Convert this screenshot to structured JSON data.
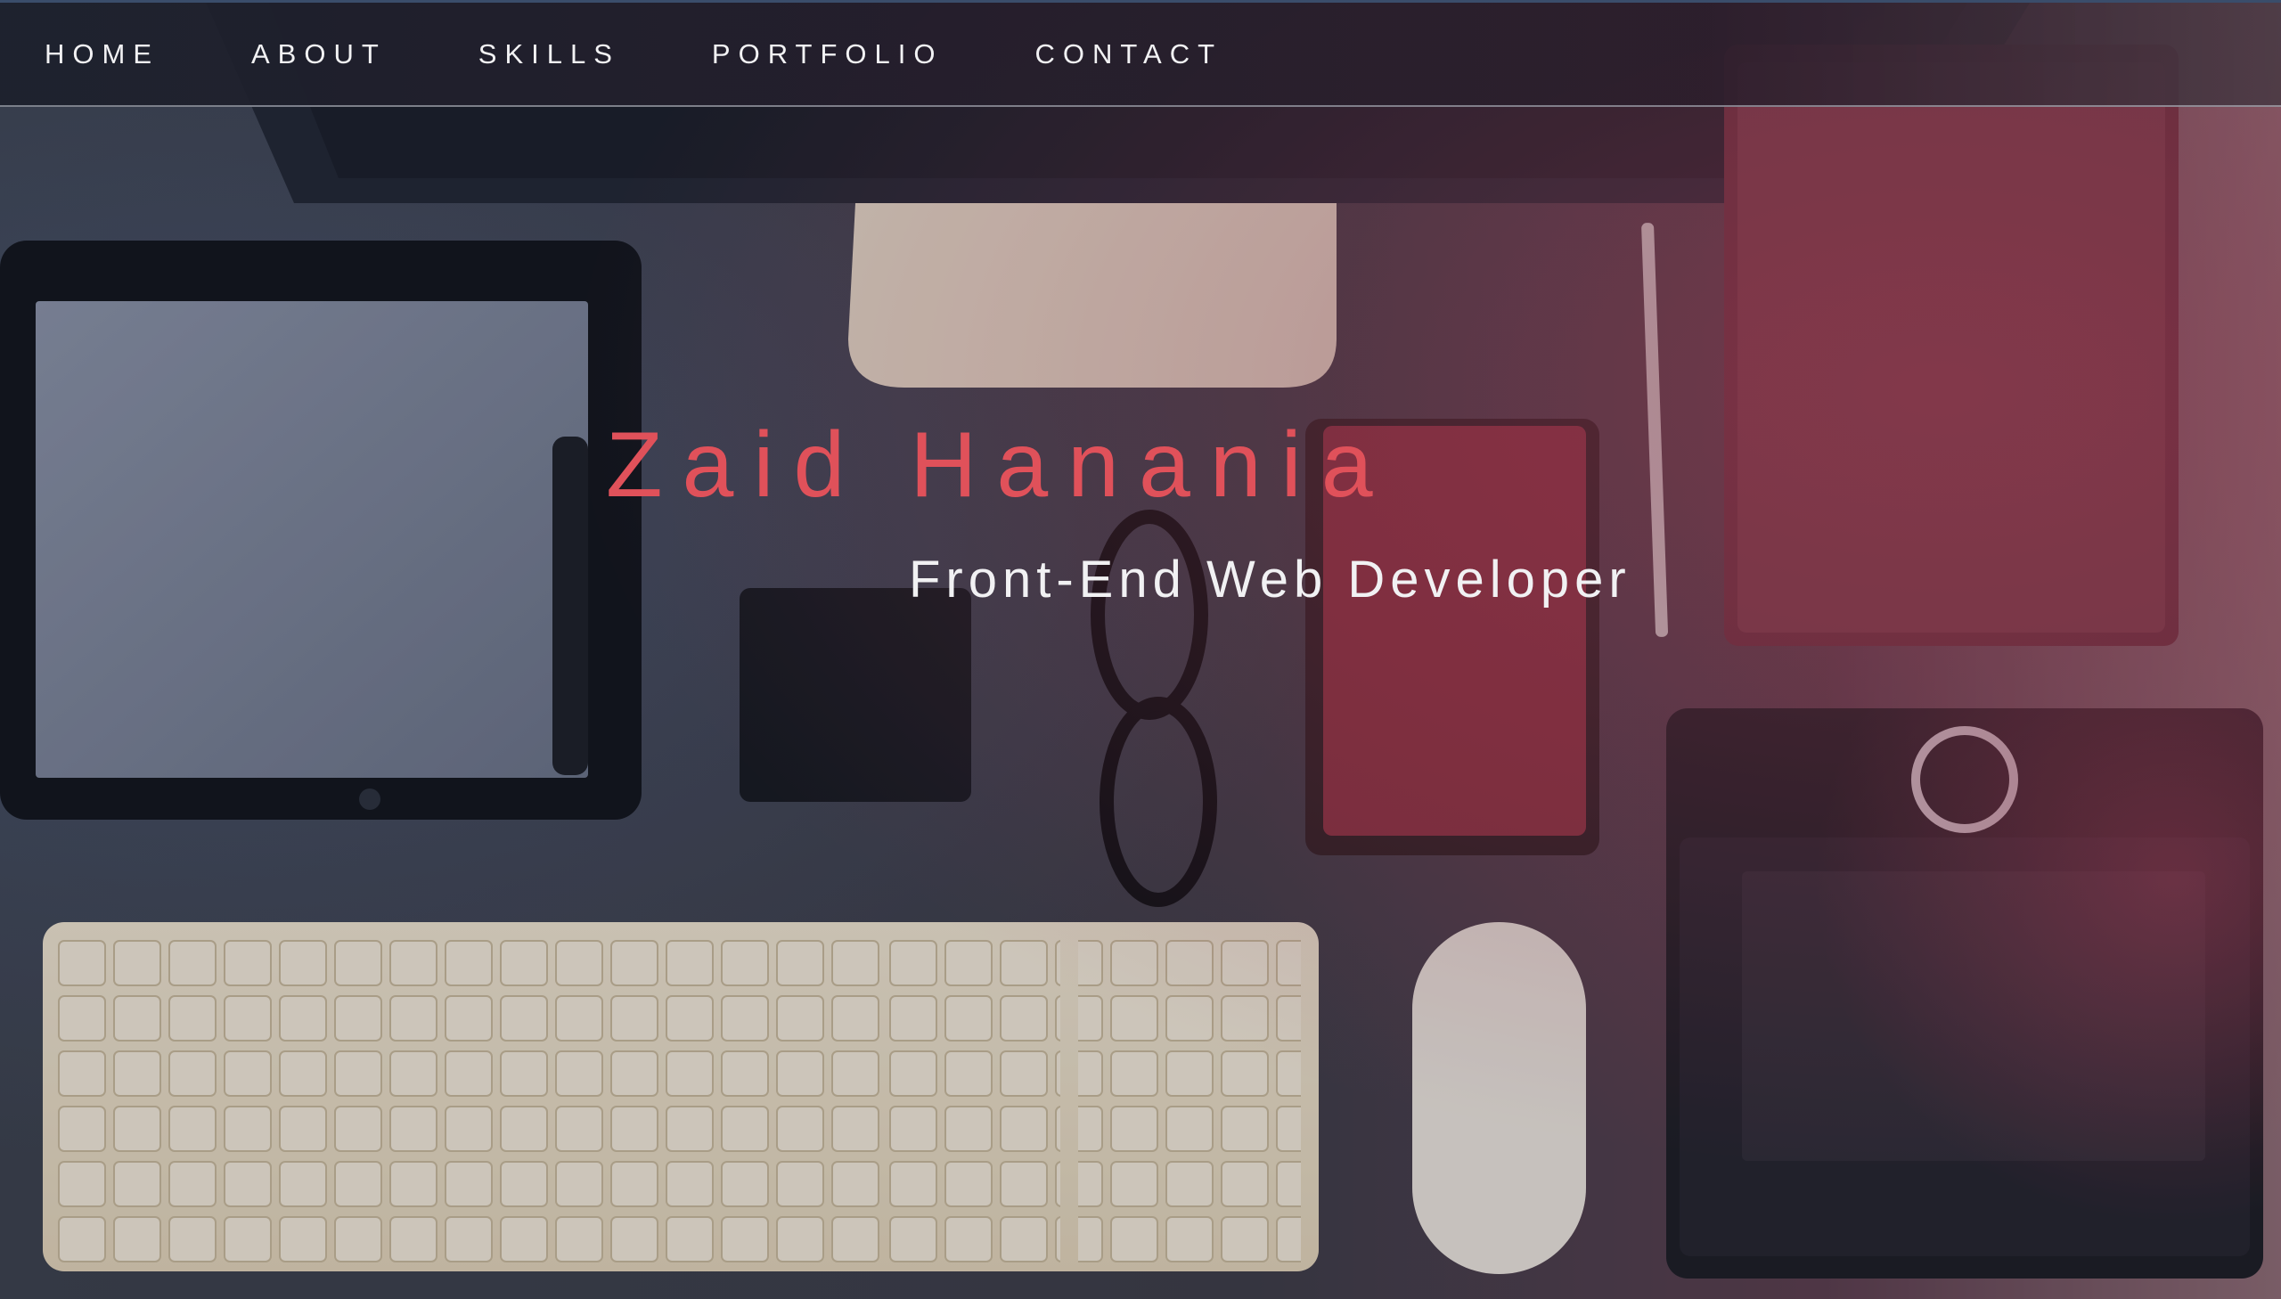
{
  "nav": {
    "items": [
      {
        "label": "HOME"
      },
      {
        "label": "ABOUT"
      },
      {
        "label": "SKILLS"
      },
      {
        "label": "PORTFOLIO"
      },
      {
        "label": "CONTACT"
      }
    ]
  },
  "hero": {
    "name": "Zaid Hanania",
    "role": "Front-End Web Developer",
    "background": "desk-workspace-photo"
  },
  "colors": {
    "accent": "#e0515a",
    "nav_text": "#f2f2f4",
    "desk": "#3b3d44"
  }
}
